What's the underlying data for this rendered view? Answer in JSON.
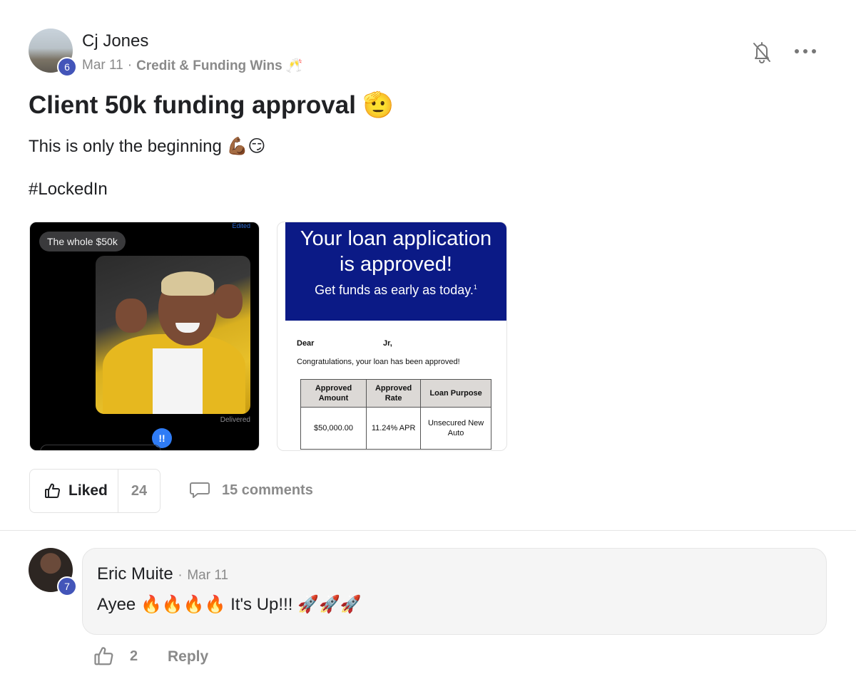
{
  "post": {
    "author": "Cj Jones",
    "author_level": "6",
    "date": "Mar 11",
    "separator": "·",
    "category": "Credit & Funding Wins 🥂",
    "title": "Client 50k funding approval 🫡",
    "body": "This is only the beginning 💪🏾😏",
    "hashtag": "#LockedIn"
  },
  "images": {
    "left": {
      "edited": "Edited",
      "bubble": "The whole $50k",
      "delivered": "Delivered",
      "reaction": "!!"
    },
    "right": {
      "headline_line1": "Your loan application",
      "headline_line2": "is approved!",
      "subhead": "Get funds as early as today.",
      "footnote": "1",
      "dear": "Dear",
      "name": "Jr,",
      "congrats": "Congratulations, your loan has been approved!",
      "table": {
        "headers": [
          "Approved Amount",
          "Approved Rate",
          "Loan Purpose"
        ],
        "values": [
          "$50,000.00",
          "11.24% APR",
          "Unsecured New Auto"
        ]
      }
    }
  },
  "actions": {
    "liked_label": "Liked",
    "like_count": "24",
    "comments_label": "15 comments"
  },
  "comment": {
    "author": "Eric Muite",
    "author_level": "7",
    "date": "Mar 11",
    "separator": "·",
    "text": "Ayee 🔥🔥🔥🔥 It's Up!!! 🚀🚀🚀",
    "like_count": "2",
    "reply_label": "Reply"
  },
  "icons": {
    "bell": "bell-off-icon",
    "more": "more-horizontal-icon",
    "like": "thumbs-up-icon",
    "comment": "comment-icon"
  },
  "colors": {
    "level_badge": "#4355b9",
    "loan_banner": "#0b1a86",
    "muted_text": "#8a8a8a"
  }
}
